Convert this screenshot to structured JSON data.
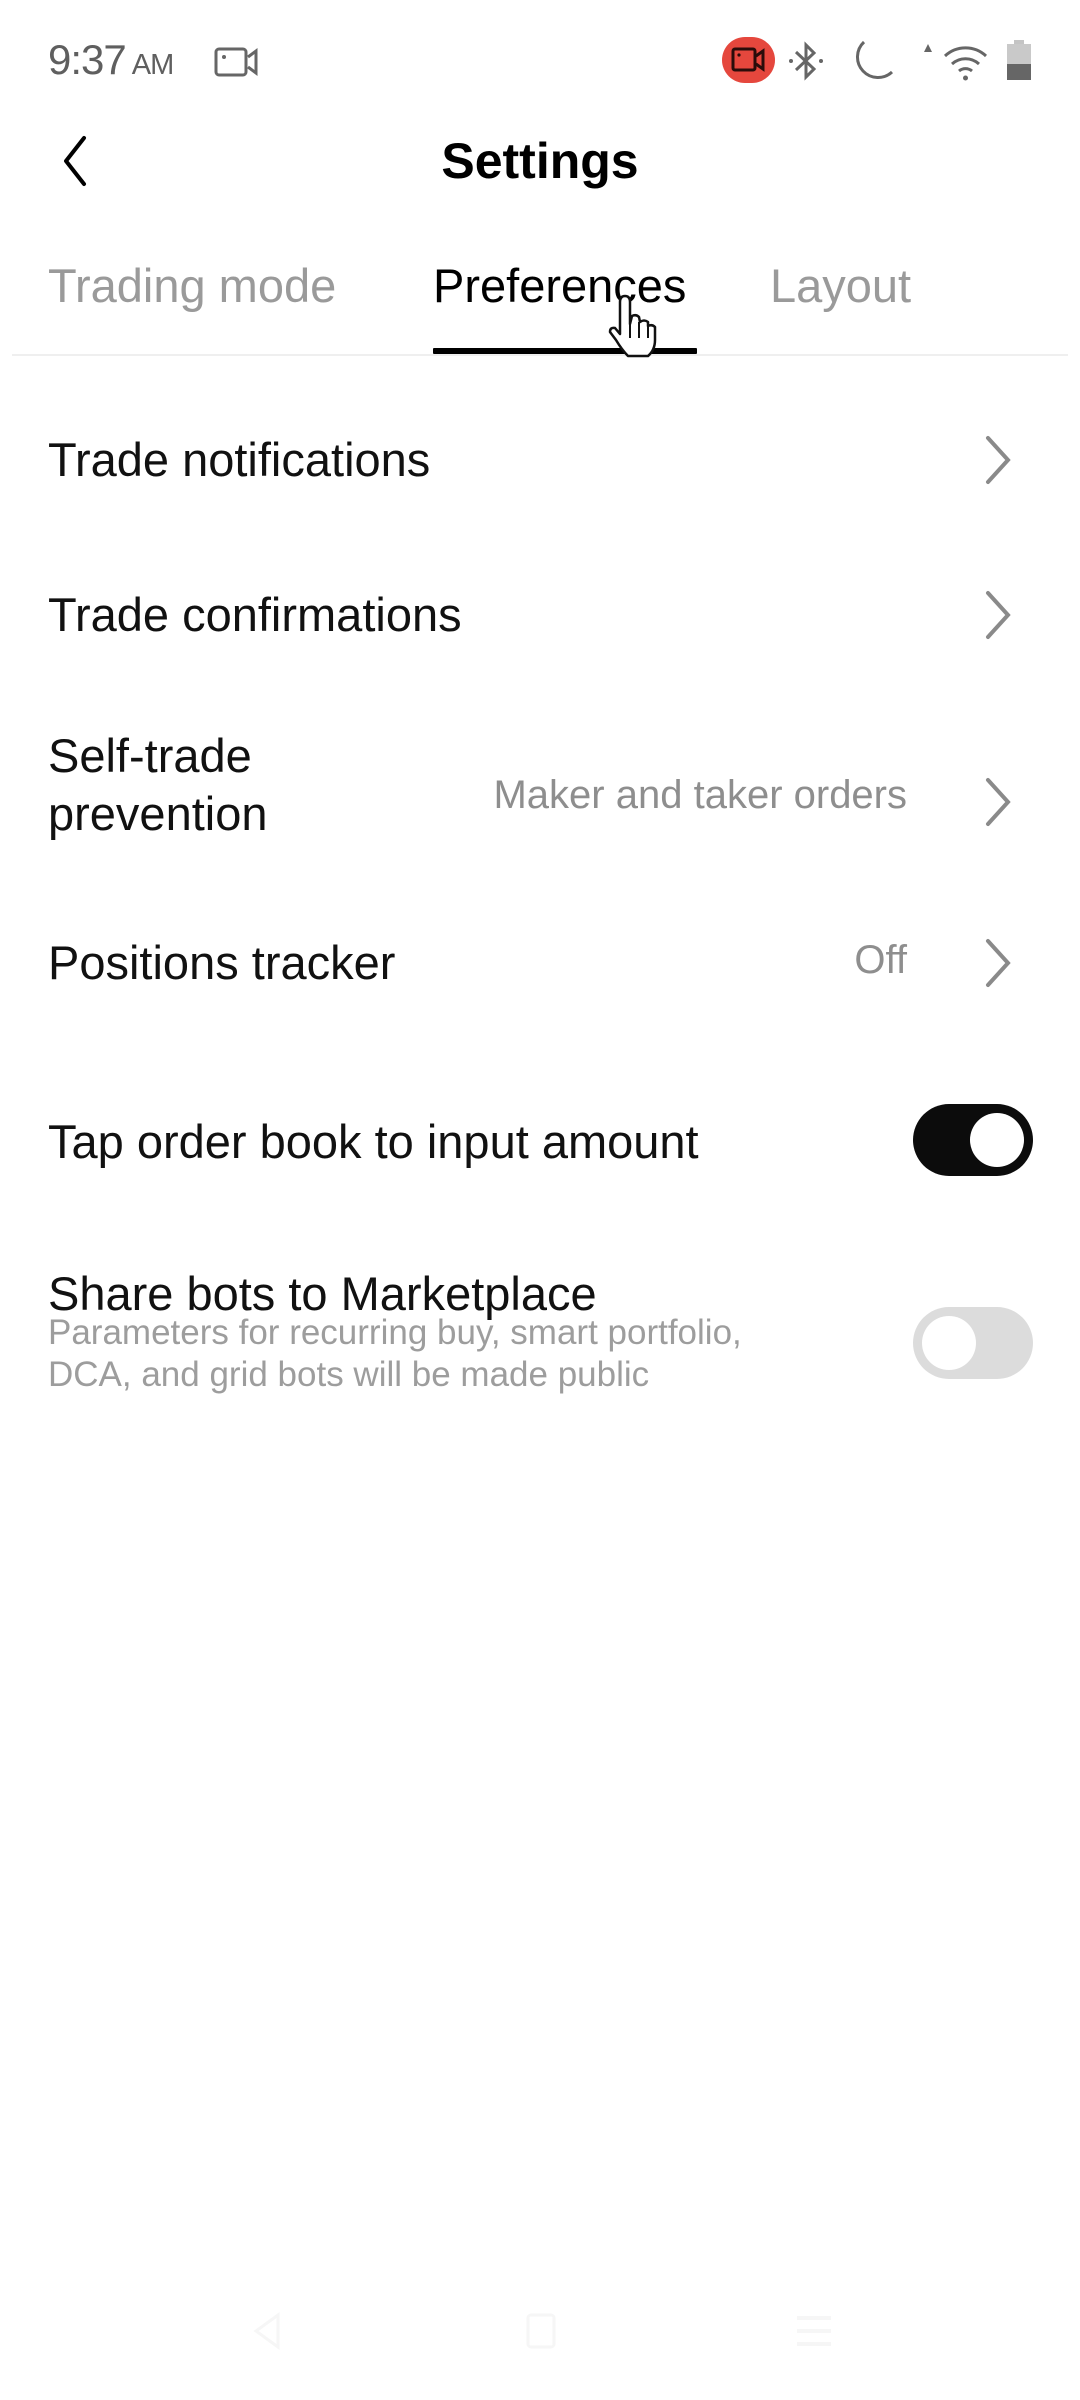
{
  "status_bar": {
    "time": "9:37",
    "ampm": "AM",
    "icons": [
      "screen-record-icon",
      "recording-indicator-icon",
      "bluetooth-icon",
      "do-not-disturb-icon",
      "wifi-icon",
      "battery-icon"
    ],
    "recording_color": "#e5473d"
  },
  "header": {
    "title": "Settings",
    "back_icon": "chevron-left-icon"
  },
  "tabs": [
    {
      "label": "Trading mode",
      "active": false
    },
    {
      "label": "Preferences",
      "active": true
    },
    {
      "label": "Layout",
      "active": false
    }
  ],
  "settings": [
    {
      "label": "Trade notifications",
      "type": "link"
    },
    {
      "label": "Trade confirmations",
      "type": "link"
    },
    {
      "label_line1": "Self-trade",
      "label_line2": "prevention",
      "label": "Self-trade prevention",
      "value": "Maker and taker orders",
      "type": "link"
    },
    {
      "label": "Positions tracker",
      "value": "Off",
      "type": "link"
    },
    {
      "label": "Tap order book to input amount",
      "type": "toggle",
      "enabled": true
    },
    {
      "label": "Share bots to Marketplace",
      "description_line1": "Parameters for recurring buy, smart portfolio,",
      "description_line2": "DCA, and grid bots will be made public",
      "type": "toggle",
      "enabled": false
    }
  ],
  "colors": {
    "toggle_on": "#0c0c0c",
    "toggle_off": "#dcdcdc",
    "secondary_text": "#8e8e8e",
    "inactive_tab": "#9a9a9a"
  },
  "nav_bar": [
    "back-nav-icon",
    "home-nav-icon",
    "recents-nav-icon"
  ]
}
